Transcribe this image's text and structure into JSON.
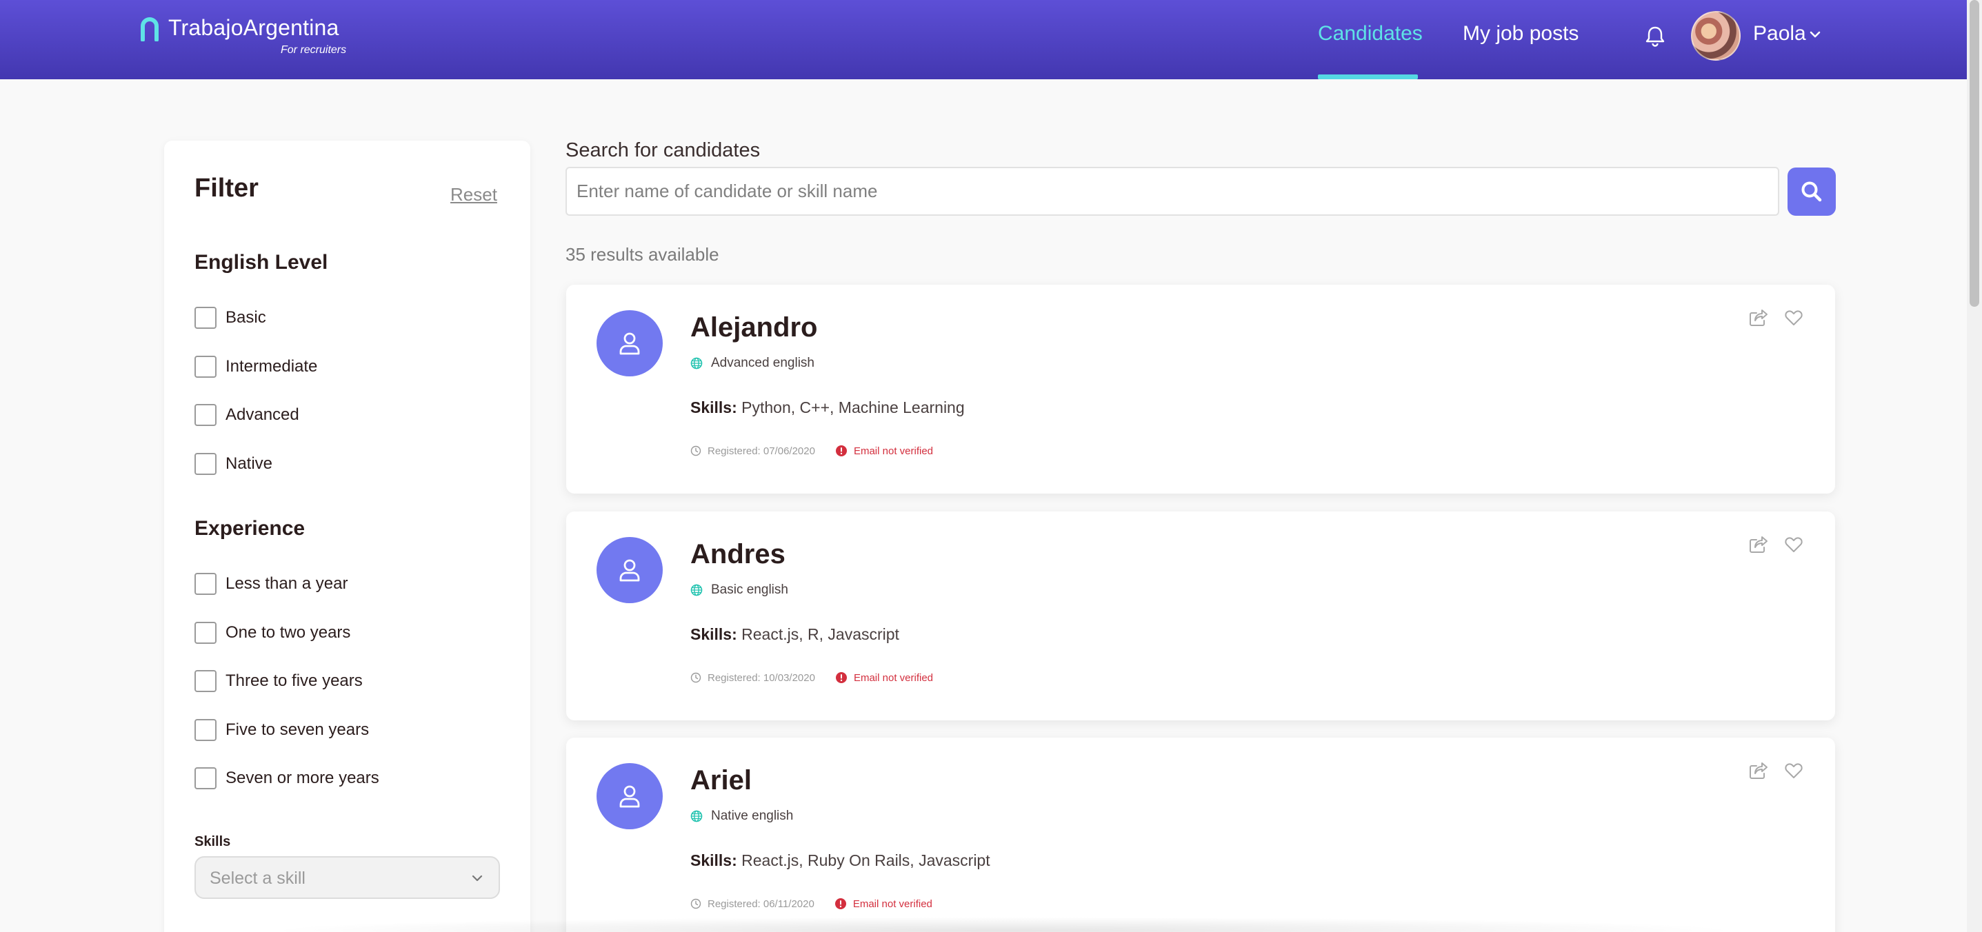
{
  "brand": {
    "name": "TrabajoArgentina",
    "subtitle": "For recruiters",
    "colors": {
      "header": "#5d4fd6",
      "accent": "#5fe3e6",
      "primary": "#6f73ee",
      "error": "#d32f3e",
      "language": "#23c3b0"
    }
  },
  "nav": {
    "candidates": "Candidates",
    "job_posts": "My job posts",
    "active": "Candidates"
  },
  "user": {
    "name": "Paola",
    "notifications_icon": "bell-icon"
  },
  "filter": {
    "title": "Filter",
    "reset": "Reset",
    "english": {
      "title": "English Level",
      "options": [
        "Basic",
        "Intermediate",
        "Advanced",
        "Native"
      ]
    },
    "experience": {
      "title": "Experience",
      "options": [
        "Less than a year",
        "One to two years",
        "Three to five years",
        "Five to seven years",
        "Seven or more years"
      ]
    },
    "skills": {
      "label": "Skills",
      "placeholder": "Select a skill"
    }
  },
  "search": {
    "label": "Search for candidates",
    "placeholder": "Enter name of candidate or skill name",
    "value": ""
  },
  "results": {
    "text": "35 results available"
  },
  "candidates": [
    {
      "name": "Alejandro",
      "english": "Advanced english",
      "skills_label": "Skills:",
      "skills": "Python, C++, Machine Learning",
      "registered": "Registered: 07/06/2020",
      "email_status": "Email not verified"
    },
    {
      "name": "Andres",
      "english": "Basic english",
      "skills_label": "Skills:",
      "skills": "React.js, R, Javascript",
      "registered": "Registered: 10/03/2020",
      "email_status": "Email not verified"
    },
    {
      "name": "Ariel",
      "english": "Native english",
      "skills_label": "Skills:",
      "skills": "React.js, Ruby On Rails, Javascript",
      "registered": "Registered: 06/11/2020",
      "email_status": "Email not verified"
    }
  ]
}
